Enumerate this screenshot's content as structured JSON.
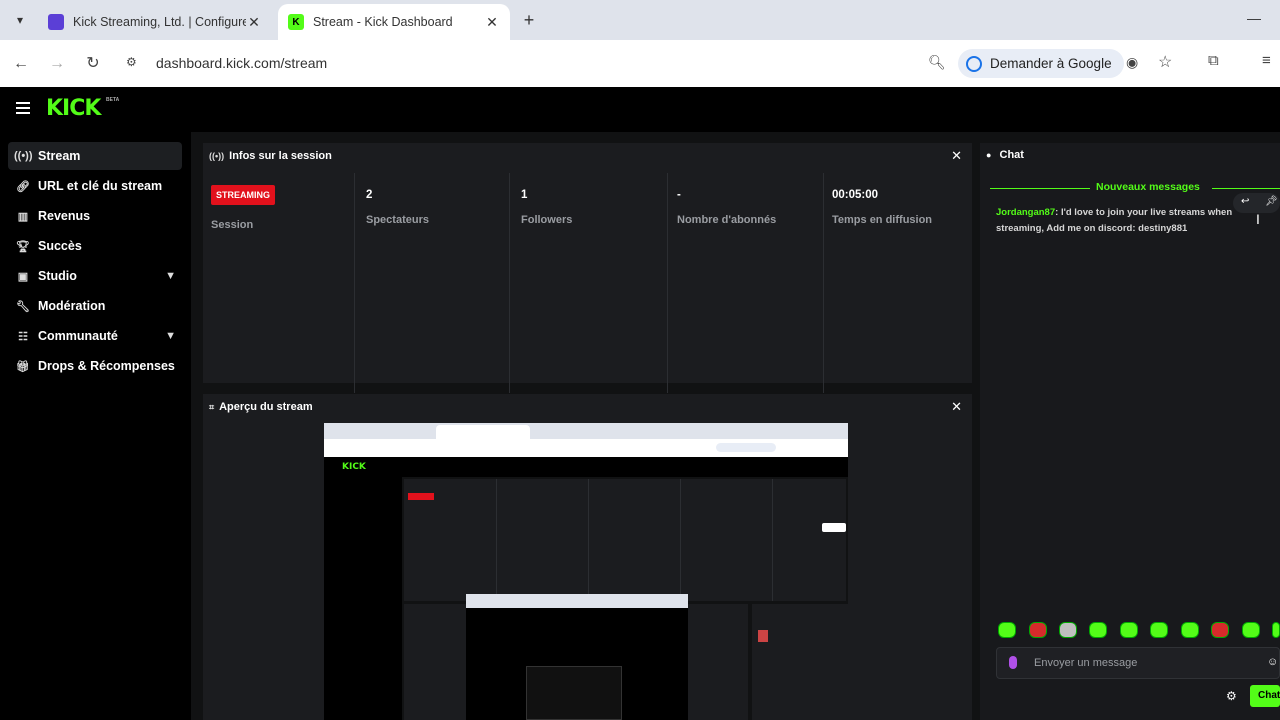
{
  "browser": {
    "tabs": [
      {
        "title": "Kick Streaming, Ltd. | Configure",
        "close": "✕"
      },
      {
        "title": "Stream - Kick Dashboard",
        "close": "✕"
      }
    ],
    "new_tab": "+",
    "minimize": "—",
    "url": "dashboard.kick.com/stream",
    "google_chip": "Demander à Google"
  },
  "app": {
    "logo": "KICK",
    "logo_badge": "BETA"
  },
  "sidebar": {
    "items": [
      {
        "label": "Stream",
        "icon": "broadcast-icon"
      },
      {
        "label": "URL et clé du stream",
        "icon": "link-icon"
      },
      {
        "label": "Revenus",
        "icon": "chart-icon"
      },
      {
        "label": "Succès",
        "icon": "trophy-icon"
      },
      {
        "label": "Studio",
        "icon": "studio-icon"
      },
      {
        "label": "Modération",
        "icon": "wrench-icon"
      },
      {
        "label": "Communauté",
        "icon": "community-icon"
      },
      {
        "label": "Drops & Récompenses",
        "icon": "gift-icon"
      }
    ]
  },
  "session_panel": {
    "title": "Infos sur la session",
    "badge": "STREAMING",
    "stats": [
      {
        "value": "",
        "label": "Session"
      },
      {
        "value": "2",
        "label": "Spectateurs"
      },
      {
        "value": "1",
        "label": "Followers"
      },
      {
        "value": "-",
        "label": "Nombre d'abonnés"
      },
      {
        "value": "00:05:00",
        "label": "Temps en diffusion"
      }
    ]
  },
  "preview_panel": {
    "title": "Aperçu du stream"
  },
  "chat": {
    "title": "Chat",
    "new_messages": "Nouveaux messages",
    "messages": [
      {
        "user": "Jordangan87",
        "text": ": I'd love to join your live streams when streaming, Add me on discord: destiny881"
      }
    ],
    "placeholder": "Envoyer un message",
    "send_label": "Chat"
  }
}
